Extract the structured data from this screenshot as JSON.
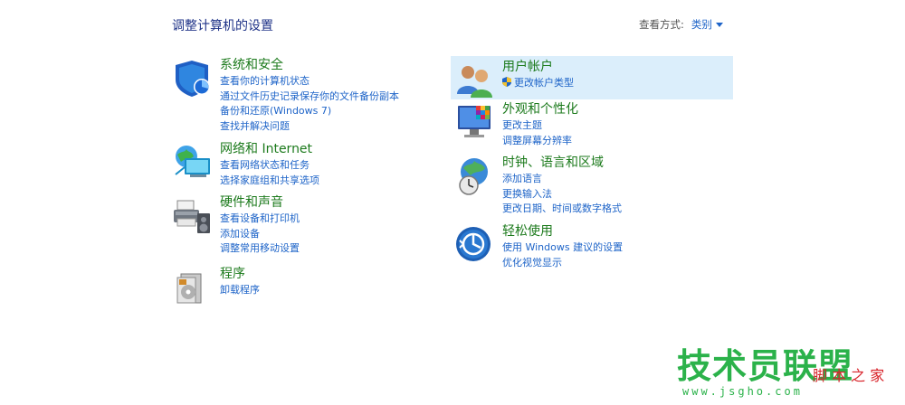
{
  "header": {
    "title": "调整计算机的设置",
    "view_by_label": "查看方式:",
    "view_by_value": "类别"
  },
  "left_categories": [
    {
      "title": "系统和安全",
      "icon": "shield-icon",
      "links": [
        "查看你的计算机状态",
        "通过文件历史记录保存你的文件备份副本",
        "备份和还原(Windows 7)",
        "查找并解决问题"
      ]
    },
    {
      "title": "网络和 Internet",
      "icon": "network-globe-icon",
      "links": [
        "查看网络状态和任务",
        "选择家庭组和共享选项"
      ]
    },
    {
      "title": "硬件和声音",
      "icon": "printer-speaker-icon",
      "links": [
        "查看设备和打印机",
        "添加设备",
        "调整常用移动设置"
      ]
    },
    {
      "title": "程序",
      "icon": "programs-disc-icon",
      "links": [
        "卸载程序"
      ]
    }
  ],
  "right_categories": [
    {
      "title": "用户帐户",
      "icon": "users-icon",
      "links": [
        "更改帐户类型"
      ]
    },
    {
      "title": "外观和个性化",
      "icon": "monitor-palette-icon",
      "links": [
        "更改主题",
        "调整屏幕分辨率"
      ]
    },
    {
      "title": "时钟、语言和区域",
      "icon": "globe-clock-icon",
      "links": [
        "添加语言",
        "更换输入法",
        "更改日期、时间或数字格式"
      ]
    },
    {
      "title": "轻松使用",
      "icon": "ease-of-access-icon",
      "links": [
        "使用 Windows 建议的设置",
        "优化视觉显示"
      ]
    }
  ],
  "watermark": {
    "main": "技术员联盟",
    "side": "脚 本 之 家",
    "url": "www.jsgho.com"
  },
  "colors": {
    "title_blue": "#1e3287",
    "link_blue": "#1e64c8",
    "category_green": "#1c7a1c",
    "highlight": "#dbeefb"
  }
}
